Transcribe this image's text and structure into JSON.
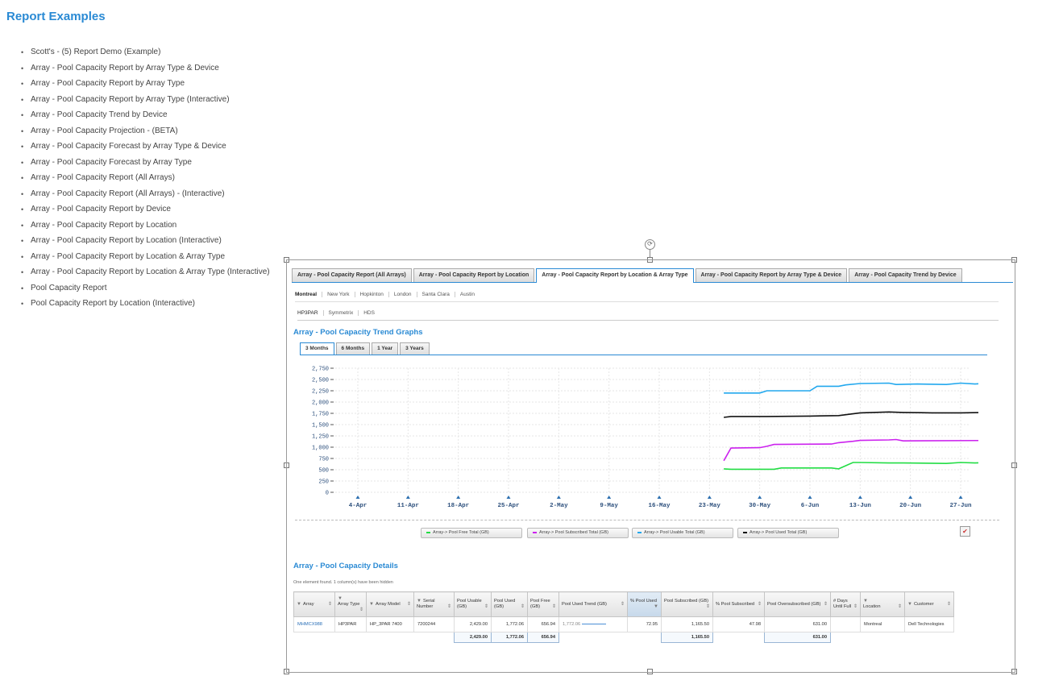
{
  "page_title": "Report Examples",
  "report_links": [
    "Scott's - (5) Report Demo (Example)",
    "Array - Pool Capacity Report by Array Type & Device",
    "Array - Pool Capacity Report by Array Type",
    "Array - Pool Capacity Report by Array Type (Interactive)",
    "Array - Pool Capacity Trend by Device",
    "Array - Pool Capacity Projection - (BETA)",
    "Array - Pool Capacity Forecast by Array Type & Device",
    "Array - Pool Capacity Forecast by Array Type",
    "Array - Pool Capacity Report (All Arrays)",
    "Array - Pool Capacity Report (All Arrays) - (Interactive)",
    "Array - Pool Capacity Report by Device",
    "Array - Pool Capacity Report by Location",
    "Array - Pool Capacity Report by Location (Interactive)",
    "Array - Pool Capacity Report by Location & Array Type",
    "Array - Pool Capacity Report by Location & Array Type (Interactive)",
    "Pool Capacity Report",
    "Pool Capacity Report by Location (Interactive)"
  ],
  "report_tabs": [
    "Array - Pool Capacity Report (All Arrays)",
    "Array - Pool Capacity Report by Location",
    "Array - Pool Capacity Report by Location & Array Type",
    "Array - Pool Capacity Report by Array Type & Device",
    "Array - Pool Capacity Trend by Device"
  ],
  "active_report_tab": 2,
  "locations": [
    "Montreal",
    "New York",
    "Hopkinton",
    "London",
    "Santa Clara",
    "Austin"
  ],
  "array_types": [
    "HP3PAR",
    "Symmetrix",
    "HDS"
  ],
  "trend_title": "Array - Pool Capacity Trend Graphs",
  "range_tabs": [
    "3 Months",
    "6 Months",
    "1 Year",
    "3 Years"
  ],
  "details_title": "Array - Pool Capacity Details",
  "hidden_note": "One element found. 1 column(s) have been hidden",
  "colors": {
    "accent": "#2a8ad4",
    "free": "#22dd44",
    "subscribed": "#cc22ee",
    "usable": "#22a8ee",
    "used": "#111111"
  },
  "chart_data": {
    "type": "line",
    "x_ticks": [
      "4-Apr",
      "11-Apr",
      "18-Apr",
      "25-Apr",
      "2-May",
      "9-May",
      "16-May",
      "23-May",
      "30-May",
      "6-Jun",
      "13-Jun",
      "20-Jun",
      "27-Jun"
    ],
    "y_ticks": [
      "2,750",
      "2,500",
      "2,250",
      "2,000",
      "1,750",
      "1,500",
      "1,250",
      "1,000",
      "750",
      "500",
      "250",
      "0"
    ],
    "ylim": [
      0,
      2750
    ],
    "x_range_days": [
      0,
      90
    ],
    "series": [
      {
        "name": "Array-> Pool Free Total (GB)",
        "color": "#22dd44",
        "x": [
          51,
          52,
          58,
          59,
          66,
          67,
          69,
          70,
          74,
          76,
          82,
          84,
          86,
          88,
          90
        ],
        "y": [
          520,
          510,
          510,
          540,
          540,
          520,
          660,
          660,
          650,
          650,
          640,
          660,
          650,
          660,
          640
        ]
      },
      {
        "name": "Array-> Pool Subscribed Total (GB)",
        "color": "#cc22ee",
        "x": [
          51,
          52,
          56,
          57,
          58,
          66,
          67,
          69,
          70,
          74,
          75,
          76,
          90
        ],
        "y": [
          700,
          980,
          990,
          1020,
          1060,
          1070,
          1100,
          1130,
          1150,
          1160,
          1170,
          1140,
          1150
        ]
      },
      {
        "name": "Array-> Pool Usable Total (GB)",
        "color": "#22a8ee",
        "x": [
          51,
          56,
          57,
          63,
          64,
          67,
          68,
          70,
          74,
          75,
          78,
          82,
          84,
          86,
          88,
          90
        ],
        "y": [
          2200,
          2200,
          2250,
          2250,
          2350,
          2350,
          2380,
          2410,
          2420,
          2390,
          2400,
          2390,
          2420,
          2400,
          2420,
          2420
        ]
      },
      {
        "name": "Array-> Pool Used Total (GB)",
        "color": "#111111",
        "x": [
          51,
          52,
          57,
          63,
          67,
          68,
          70,
          74,
          76,
          80,
          84,
          88,
          90
        ],
        "y": [
          1660,
          1680,
          1680,
          1690,
          1700,
          1720,
          1760,
          1780,
          1770,
          1760,
          1760,
          1770,
          1770
        ]
      }
    ]
  },
  "table": {
    "headers": [
      "Array",
      "Array Type",
      "Array Model",
      "Serial Number",
      "Pool Usable (GB)",
      "Pool Used (GB)",
      "Pool Free (GB)",
      "Pool Used Trend (GB)",
      "% Pool Used",
      "Pool Subscribed (GB)",
      "% Pool Subscribed",
      "Pool Oversubscribed (GB)",
      "# Days Until Full",
      "Location",
      "Customer"
    ],
    "rows": [
      [
        "MHMCX988",
        "HP3PAR",
        "HP_3PAR 7400",
        "7200244",
        "2,429.00",
        "1,772.06",
        "656.94",
        "1,772.06",
        "72.95",
        "1,165.50",
        "47.98",
        "631.00",
        "",
        "Montreal",
        "Dell Technologies"
      ]
    ],
    "totals": {
      "usable": "2,429.00",
      "used": "1,772.06",
      "free": "656.94",
      "subscribed": "1,165.50",
      "oversubscribed": "631.00"
    }
  }
}
